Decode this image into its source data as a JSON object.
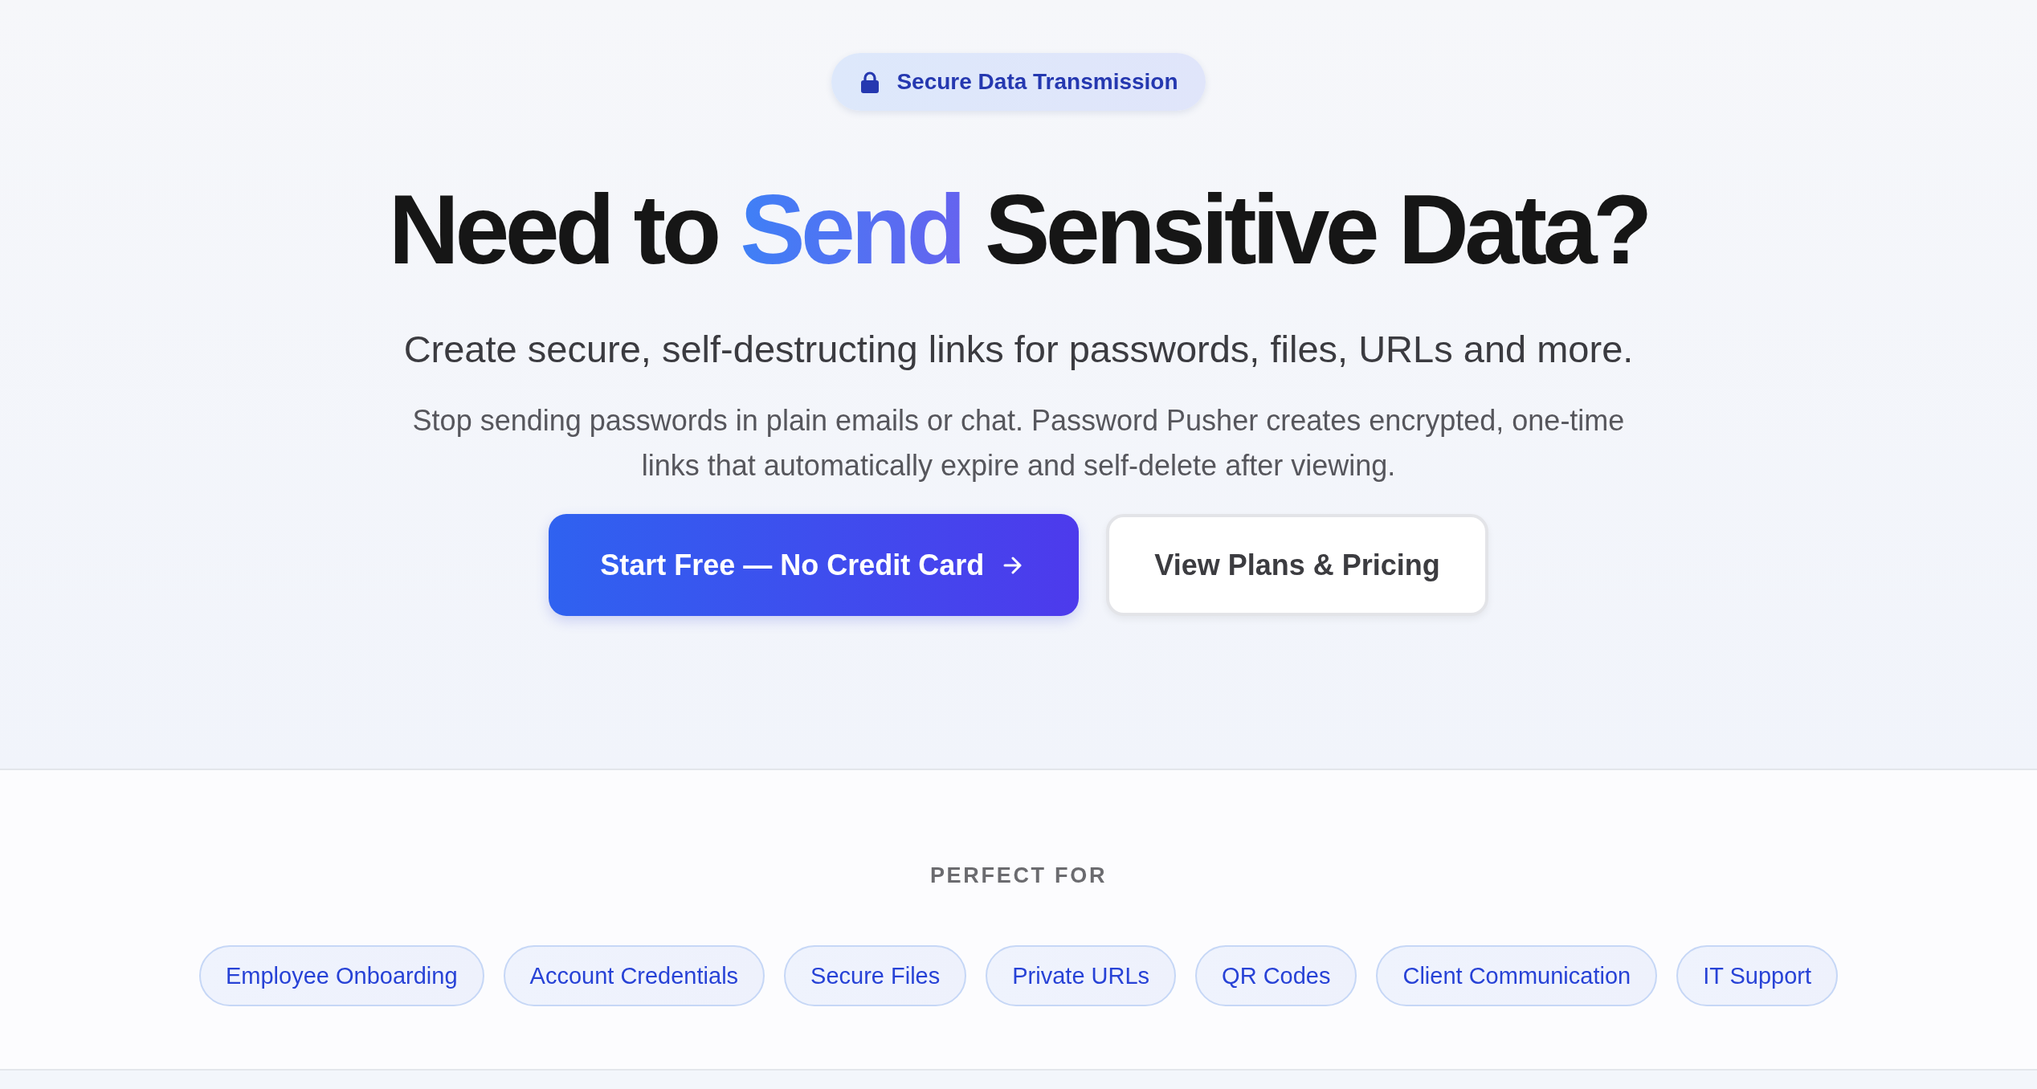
{
  "hero": {
    "badge": {
      "label": "Secure Data Transmission"
    },
    "headline": [
      {
        "text": "Need to ",
        "highlighted": false
      },
      {
        "text": "Send",
        "highlighted": true
      },
      {
        "text": " Sensitive Data?",
        "highlighted": false
      }
    ],
    "subtitle": "Create secure, self-destructing links for passwords, files, URLs and more.",
    "description": "Stop sending passwords in plain emails or chat. Password Pusher creates encrypted, one-time links that automatically expire and self-delete after viewing.",
    "buttons": [
      {
        "label": "Start Free — No Credit Card",
        "kind": "primary"
      },
      {
        "label": "View Plans & Pricing",
        "kind": "secondary"
      }
    ]
  },
  "use_cases": {
    "heading": "PERFECT FOR",
    "tags": [
      "Employee Onboarding",
      "Account Credentials",
      "Secure Files",
      "Private URLs",
      "QR Codes",
      "Client Communication",
      "IT Support"
    ]
  }
}
